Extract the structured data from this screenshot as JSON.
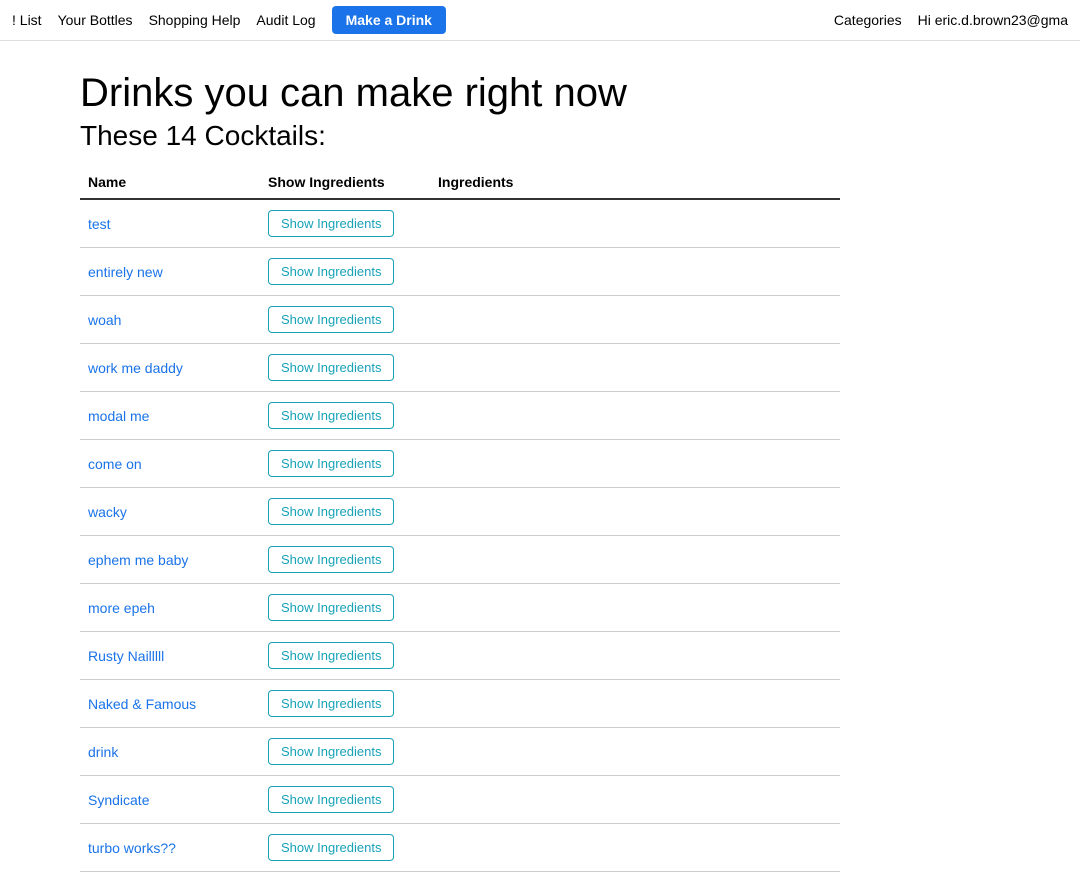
{
  "nav": {
    "links": [
      {
        "label": "! List",
        "name": "nav-list"
      },
      {
        "label": "Your Bottles",
        "name": "nav-your-bottles"
      },
      {
        "label": "Shopping Help",
        "name": "nav-shopping-help"
      },
      {
        "label": "Audit Log",
        "name": "nav-audit-log"
      }
    ],
    "make_drink_label": "Make a Drink",
    "categories_label": "Categories",
    "user_greeting": "Hi eric.d.brown23@gma"
  },
  "page": {
    "heading": "Drinks you can make right now",
    "subheading": "These 14 Cocktails:"
  },
  "table": {
    "columns": [
      "Name",
      "Show Ingredients",
      "Ingredients"
    ],
    "show_ingredients_label": "Show Ingredients",
    "rows": [
      {
        "name": "test"
      },
      {
        "name": "entirely new"
      },
      {
        "name": "woah"
      },
      {
        "name": "work me daddy"
      },
      {
        "name": "modal me"
      },
      {
        "name": "come on"
      },
      {
        "name": "wacky"
      },
      {
        "name": "ephem me baby"
      },
      {
        "name": "more epeh"
      },
      {
        "name": "Rusty Nailllll"
      },
      {
        "name": "Naked & Famous"
      },
      {
        "name": "drink"
      },
      {
        "name": "Syndicate"
      },
      {
        "name": "turbo works??"
      }
    ]
  }
}
